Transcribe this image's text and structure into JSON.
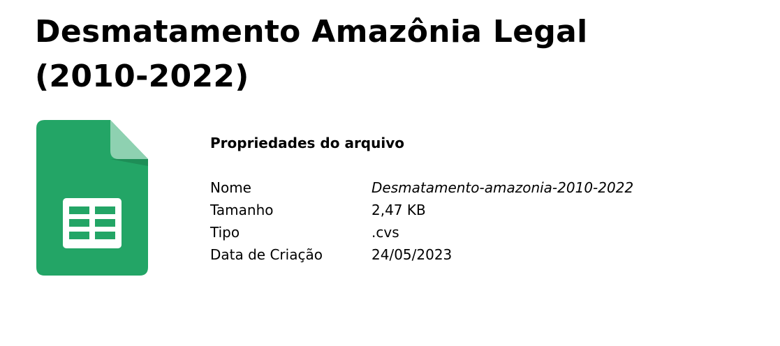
{
  "title": {
    "line1": "Desmatamento Amazônia Legal",
    "line2": "(2010-2022)"
  },
  "icon": {
    "name": "google-sheets-icon",
    "color_primary": "#23A566",
    "color_fold": "#8ED1B1",
    "color_fold_shadow": "#1E8E57",
    "color_grid_bg": "#ffffff"
  },
  "properties": {
    "heading": "Propriedades do arquivo",
    "rows": [
      {
        "label": "Nome",
        "value": "Desmatamento-amazonia-2010-2022"
      },
      {
        "label": "Tamanho",
        "value": "2,47 KB"
      },
      {
        "label": "Tipo",
        "value": ".cvs"
      },
      {
        "label": "Data de Criação",
        "value": "24/05/2023"
      }
    ]
  }
}
